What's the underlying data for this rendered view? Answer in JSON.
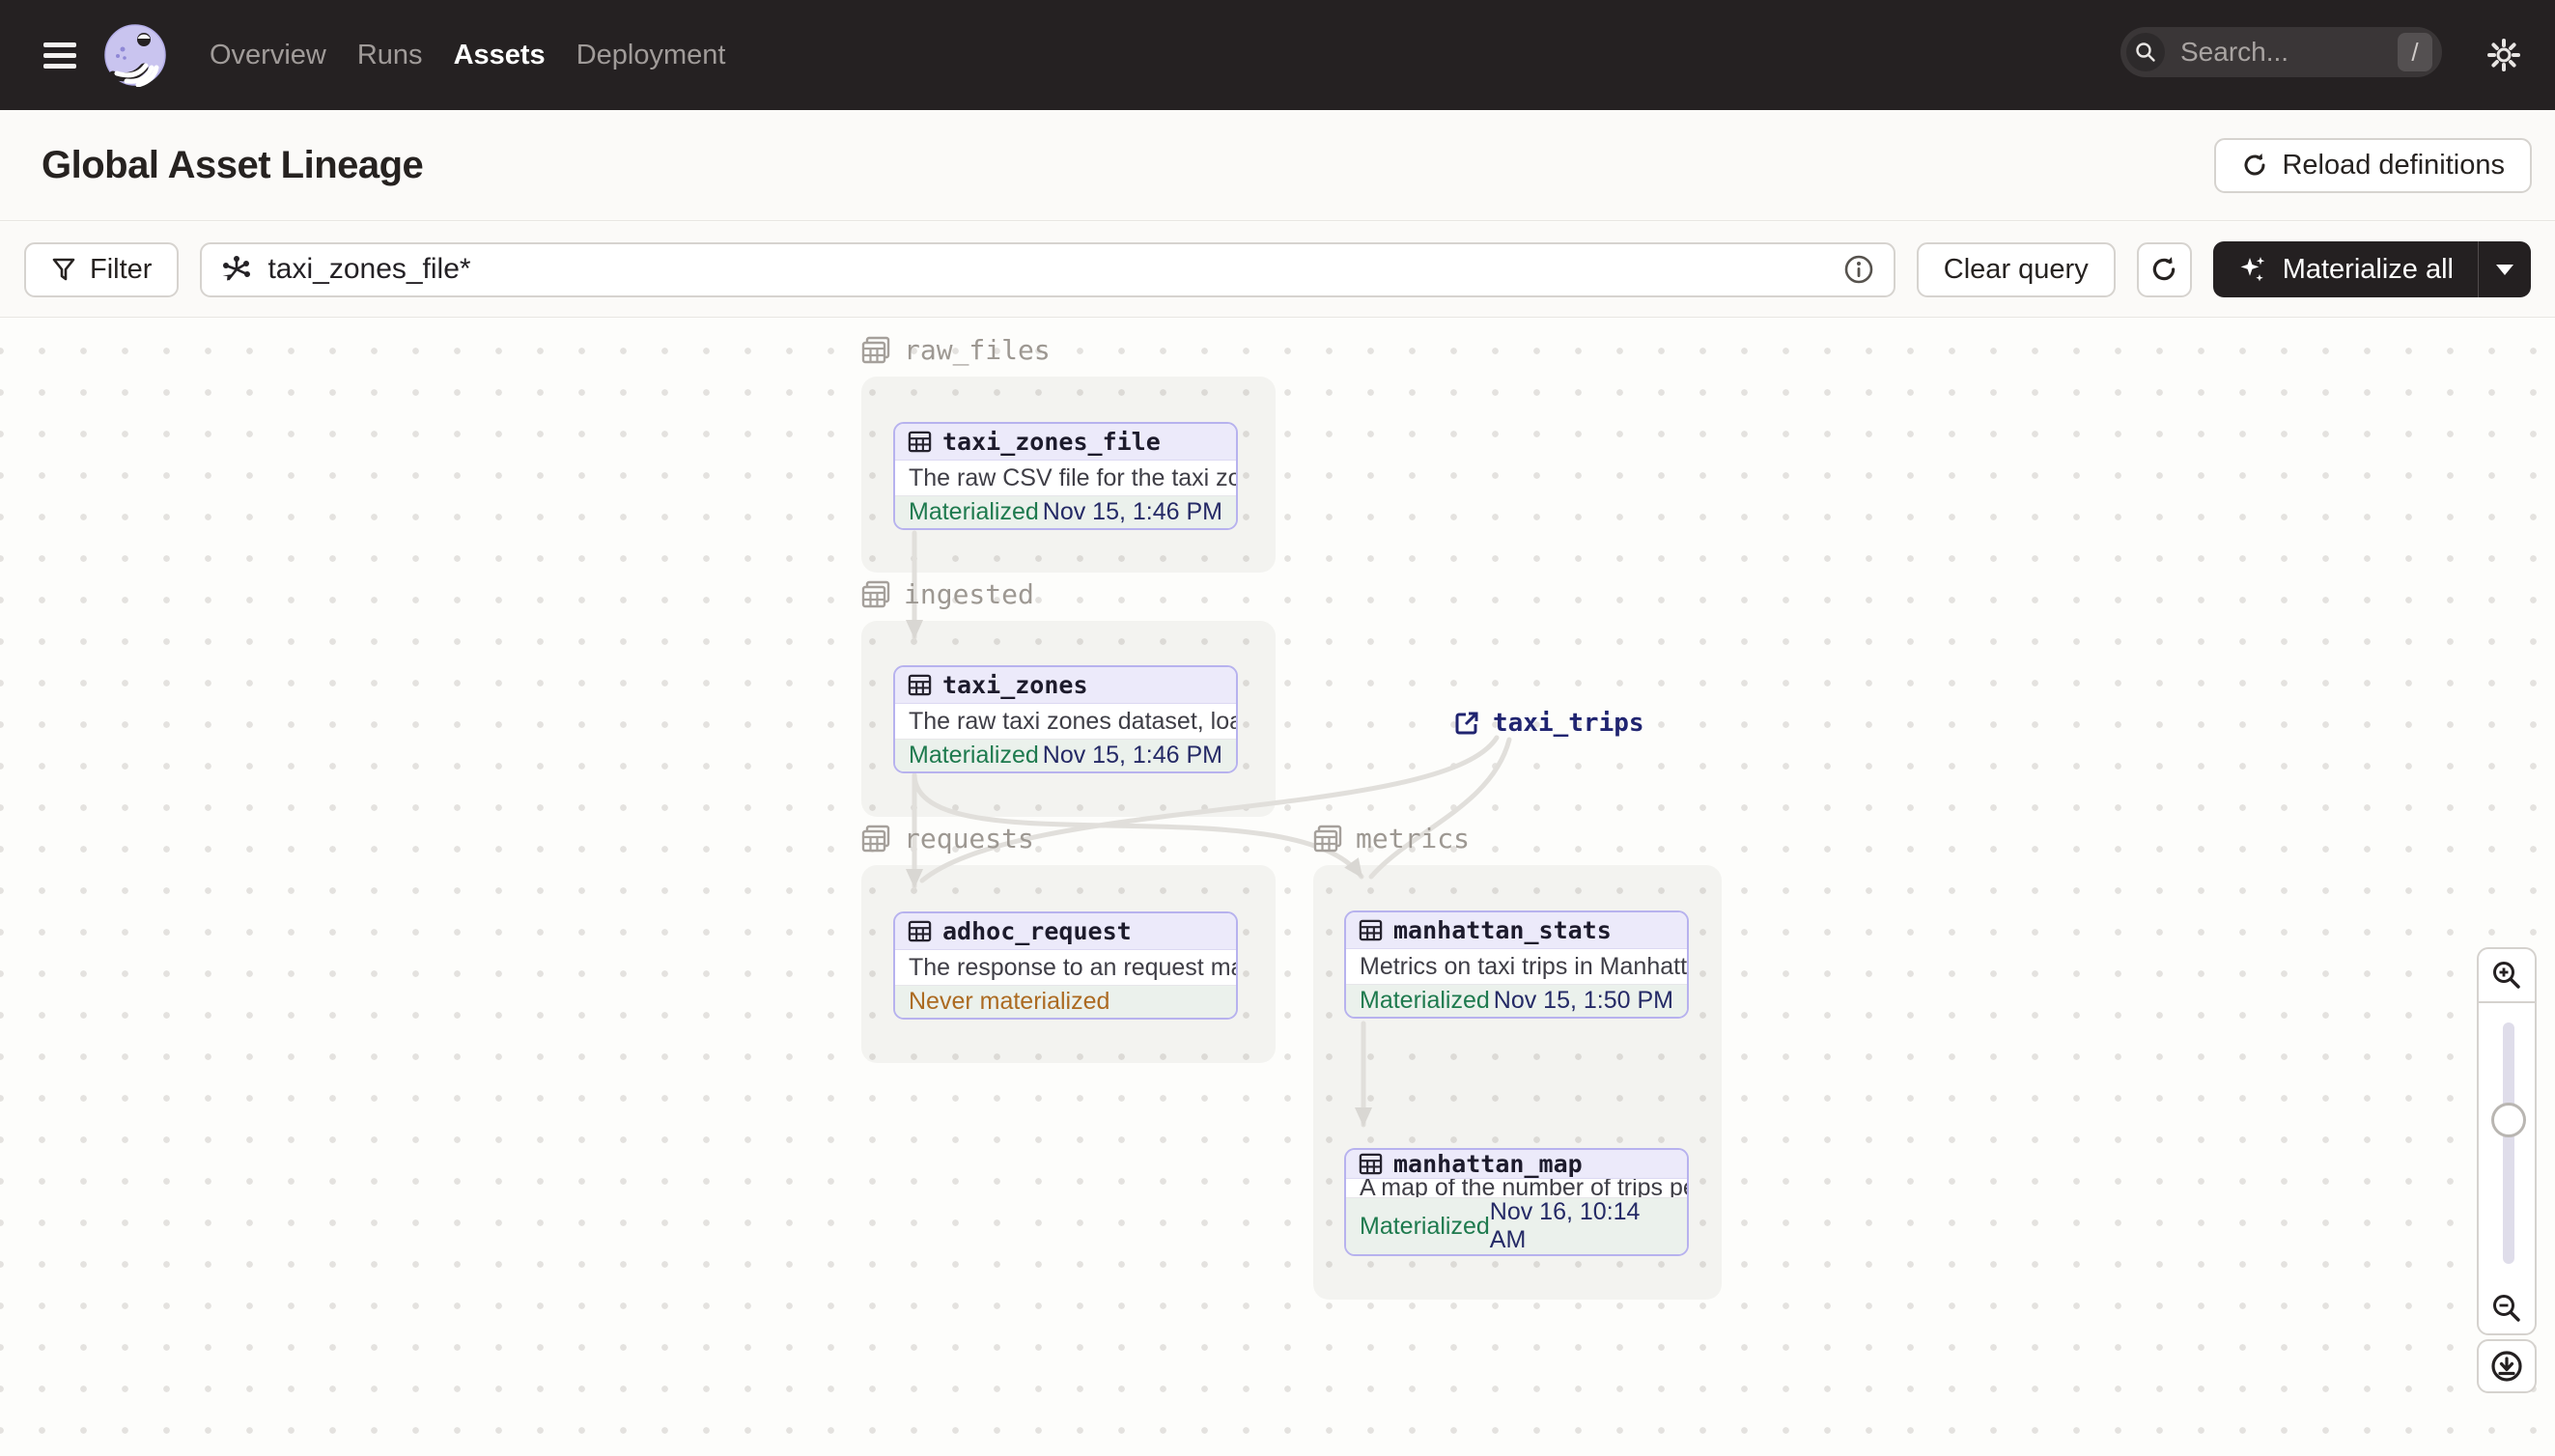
{
  "nav": {
    "items": [
      {
        "label": "Overview",
        "active": false
      },
      {
        "label": "Runs",
        "active": false
      },
      {
        "label": "Assets",
        "active": true
      },
      {
        "label": "Deployment",
        "active": false
      }
    ],
    "search": {
      "placeholder": "Search...",
      "shortcut": "/"
    }
  },
  "header": {
    "title": "Global Asset Lineage",
    "reload_button": "Reload definitions"
  },
  "toolbar": {
    "filter_label": "Filter",
    "query_value": "taxi_zones_file*",
    "clear_button": "Clear query",
    "materialize_button": "Materialize all"
  },
  "graph": {
    "groups": [
      {
        "name": "raw_files"
      },
      {
        "name": "ingested"
      },
      {
        "name": "requests"
      },
      {
        "name": "metrics"
      }
    ],
    "nodes": [
      {
        "name": "taxi_zones_file",
        "description": "The raw CSV file for the taxi zones dat...",
        "status": "Materialized",
        "timestamp": "Nov 15, 1:46 PM",
        "group": "raw_files"
      },
      {
        "name": "taxi_zones",
        "description": "The raw taxi zones dataset, loaded int...",
        "status": "Materialized",
        "timestamp": "Nov 15, 1:46 PM",
        "group": "ingested"
      },
      {
        "name": "adhoc_request",
        "description": "The response to an request made in th...",
        "status": "Never materialized",
        "timestamp": "",
        "group": "requests"
      },
      {
        "name": "manhattan_stats",
        "description": "Metrics on taxi trips in Manhattan",
        "status": "Materialized",
        "timestamp": "Nov 15, 1:50 PM",
        "group": "metrics"
      },
      {
        "name": "manhattan_map",
        "description": "A map of the number of trips per taxi z...",
        "status": "Materialized",
        "timestamp": "Nov 16, 10:14 AM",
        "group": "metrics"
      }
    ],
    "external_assets": [
      {
        "name": "taxi_trips"
      }
    ],
    "edges": [
      "taxi_zones_file -> taxi_zones",
      "taxi_zones -> adhoc_request",
      "taxi_zones -> manhattan_stats",
      "taxi_trips -> adhoc_request",
      "taxi_trips -> manhattan_stats",
      "manhattan_stats -> manhattan_map"
    ]
  },
  "colors": {
    "nav_bg": "#252122",
    "node_border": "#B7B2EE",
    "node_header_bg": "#ECEAFA",
    "materialized_green": "#1E7A4E",
    "never_materialized_orange": "#AC6A21",
    "timestamp_navy": "#252A66",
    "edge_gray": "#E1DFDB",
    "accent_dark": "#242021"
  }
}
